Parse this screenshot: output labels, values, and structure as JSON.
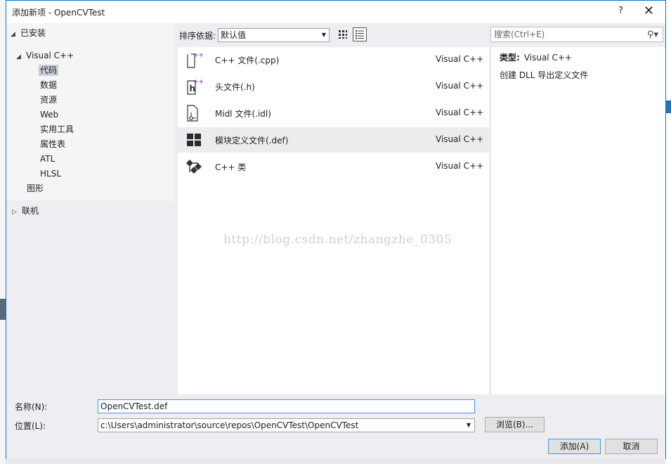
{
  "dialog": {
    "title": "添加新项 - OpenCVTest",
    "help": "?",
    "close": "✕"
  },
  "tree": {
    "installed": "已安装",
    "visual_cpp": "Visual C++",
    "children": [
      "代码",
      "数据",
      "资源",
      "Web",
      "实用工具",
      "属性表",
      "ATL",
      "HLSL"
    ],
    "graphics": "图形",
    "online": "联机"
  },
  "sort": {
    "label": "排序依据:",
    "value": "默认值"
  },
  "items": [
    {
      "name": "C++ 文件(.cpp)",
      "lang": "Visual C++",
      "icon": "cpp-file-icon"
    },
    {
      "name": "头文件(.h)",
      "lang": "Visual C++",
      "icon": "header-file-icon"
    },
    {
      "name": "Midl 文件(.idl)",
      "lang": "Visual C++",
      "icon": "midl-file-icon"
    },
    {
      "name": "模块定义文件(.def)",
      "lang": "Visual C++",
      "icon": "module-def-icon"
    },
    {
      "name": "C++ 类",
      "lang": "Visual C++",
      "icon": "cpp-class-icon"
    }
  ],
  "watermark": "http://blog.csdn.net/zhangzhe_0305",
  "search": {
    "placeholder": "搜索(Ctrl+E)"
  },
  "details": {
    "type_label": "类型:",
    "type_value": "Visual C++",
    "description": "创建 DLL 导出定义文件"
  },
  "form": {
    "name_label": "名称(N):",
    "name_value": "OpenCVTest.def",
    "location_label": "位置(L):",
    "location_value": "c:\\Users\\administrator\\source\\repos\\OpenCVTest\\OpenCVTest",
    "browse": "浏览(B)...",
    "add": "添加(A)",
    "cancel": "取消"
  },
  "colors": {
    "accent": "#007acc",
    "icon_purple": "#9b4dca",
    "selection": "#cccedb"
  }
}
